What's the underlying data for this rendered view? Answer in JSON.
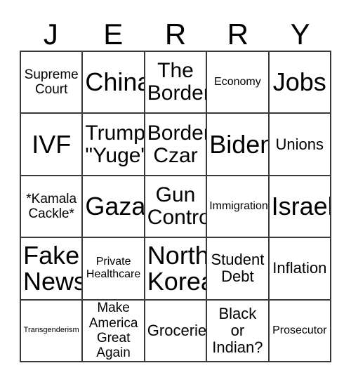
{
  "header": {
    "letters": [
      "J",
      "E",
      "R",
      "R",
      "Y"
    ]
  },
  "grid": {
    "rows": 5,
    "columns": 5,
    "border_color": "#3a3a3a",
    "background_color": "#ffffff",
    "text_color": "#000000",
    "cells": [
      {
        "text": "Supreme\nCourt",
        "size": "sz-m"
      },
      {
        "text": "China",
        "size": "sz-xxl"
      },
      {
        "text": "The\nBorder",
        "size": "sz-xl"
      },
      {
        "text": "Economy",
        "size": "sz-s"
      },
      {
        "text": "Jobs",
        "size": "sz-xxl"
      },
      {
        "text": "IVF",
        "size": "sz-xxl"
      },
      {
        "text": "Trump\n\"Yuge\"",
        "size": "sz-xl"
      },
      {
        "text": "Border\nCzar",
        "size": "sz-xl"
      },
      {
        "text": "Biden",
        "size": "sz-xxl"
      },
      {
        "text": "Unions",
        "size": "sz-ml"
      },
      {
        "text": "*Kamala\nCackle*",
        "size": "sz-m"
      },
      {
        "text": "Gaza",
        "size": "sz-xxl"
      },
      {
        "text": "Gun\nControl",
        "size": "sz-xl"
      },
      {
        "text": "Immigration",
        "size": "sz-s"
      },
      {
        "text": "Israel",
        "size": "sz-xxl"
      },
      {
        "text": "Fake\nNews",
        "size": "sz-xxl"
      },
      {
        "text": "Private\nHealthcare",
        "size": "sz-s"
      },
      {
        "text": "North\nKorea",
        "size": "sz-xxl"
      },
      {
        "text": "Student\nDebt",
        "size": "sz-ml"
      },
      {
        "text": "Inflation",
        "size": "sz-ml"
      },
      {
        "text": "Transgenderism",
        "size": "sz-xs"
      },
      {
        "text": "Make\nAmerica\nGreat\nAgain",
        "size": "sz-m"
      },
      {
        "text": "Groceries",
        "size": "sz-ml"
      },
      {
        "text": "Black\nor\nIndian?",
        "size": "sz-ml"
      },
      {
        "text": "Prosecutor",
        "size": "sz-s"
      }
    ]
  }
}
